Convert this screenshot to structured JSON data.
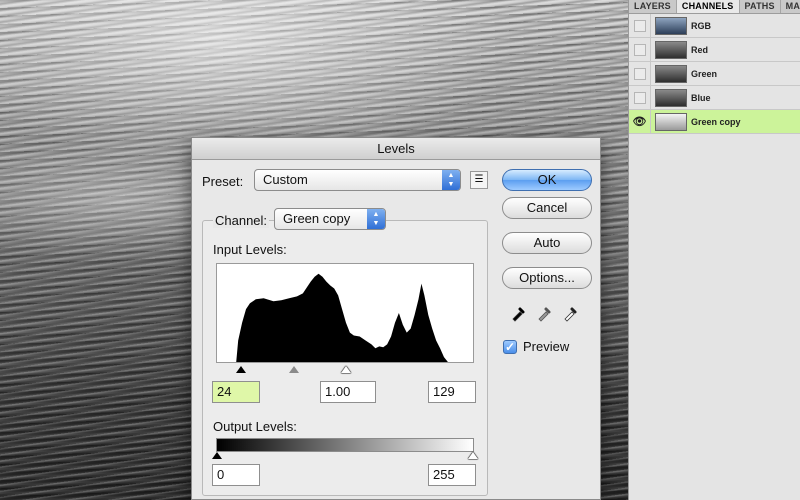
{
  "colors": {
    "active_channel_bg": "#ccf39a",
    "default_button": "#5c9ef0",
    "highlight_field": "#dff7a8"
  },
  "panel": {
    "tabs": [
      "LAYERS",
      "CHANNELS",
      "PATHS",
      "MASKS"
    ],
    "active_tab": "CHANNELS",
    "channels": [
      {
        "name": "RGB",
        "visible": false,
        "active": false
      },
      {
        "name": "Red",
        "visible": false,
        "active": false
      },
      {
        "name": "Green",
        "visible": false,
        "active": false
      },
      {
        "name": "Blue",
        "visible": false,
        "active": false
      },
      {
        "name": "Green copy",
        "visible": true,
        "active": true
      }
    ]
  },
  "dialog": {
    "title": "Levels",
    "preset_label": "Preset:",
    "preset_value": "Custom",
    "channel_label": "Channel:",
    "channel_value": "Green copy",
    "input_levels_label": "Input Levels:",
    "input_black": "24",
    "input_gamma": "1.00",
    "input_white": "129",
    "output_levels_label": "Output Levels:",
    "output_black": "0",
    "output_white": "255",
    "buttons": {
      "ok": "OK",
      "cancel": "Cancel",
      "auto": "Auto",
      "options": "Options..."
    },
    "preview_label": "Preview",
    "preview_checked": true
  }
}
